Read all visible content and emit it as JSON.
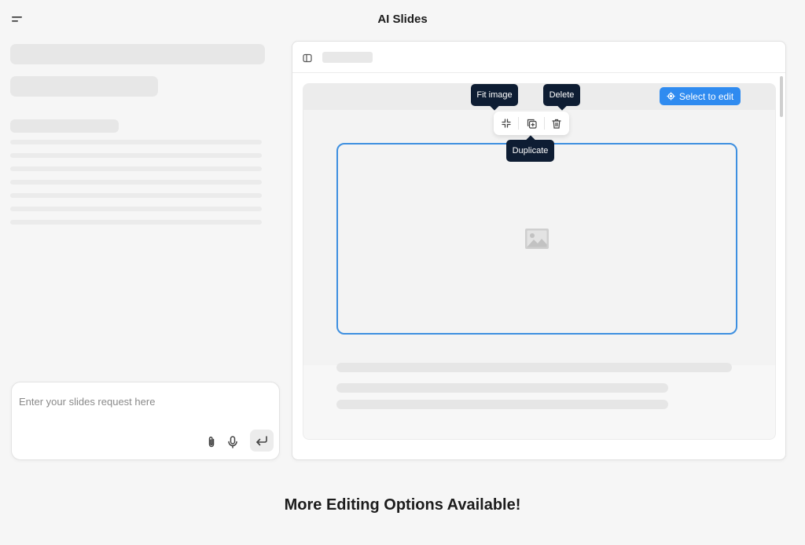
{
  "header": {
    "title": "AI Slides",
    "menu_icon": "menu-icon"
  },
  "prompt": {
    "placeholder": "Enter your slides request here",
    "value": "",
    "attach_icon": "paperclip-icon",
    "mic_icon": "microphone-icon",
    "submit_icon": "enter-arrow-icon"
  },
  "preview": {
    "toggle_icon": "sidebar-toggle-icon",
    "select_to_edit_label": "Select to edit",
    "select_icon": "target-icon",
    "image_placeholder_icon": "image-placeholder-icon",
    "toolbar": {
      "fit_icon": "fit-image-icon",
      "duplicate_icon": "duplicate-icon",
      "delete_icon": "trash-icon"
    },
    "tooltips": {
      "fit_image": "Fit image",
      "delete": "Delete",
      "duplicate": "Duplicate"
    }
  },
  "footer": {
    "text": "More Editing Options Available!"
  },
  "colors": {
    "accent": "#2f8bf0",
    "selection_border": "#3d8fe0",
    "tooltip_bg": "#0e1d33",
    "background": "#f6f6f6"
  }
}
